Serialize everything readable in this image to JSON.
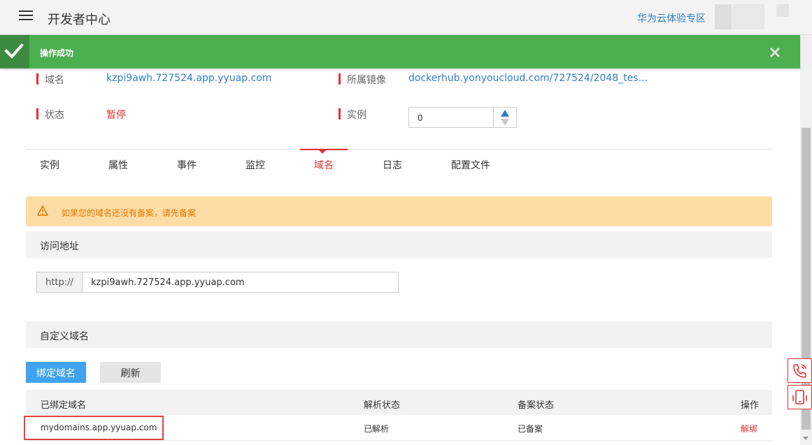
{
  "header": {
    "title": "开发者中心",
    "cloud_link": "华为云体验专区"
  },
  "toast": {
    "message": "操作成功"
  },
  "info": {
    "domain_label": "域名",
    "domain_value": "kzpi9awh.727524.app.yyuap.com",
    "image_label": "所属镜像",
    "image_value": "dockerhub.yonyoucloud.com/727524/2048_tes...",
    "status_label": "状态",
    "status_value": "暂停",
    "instance_label": "实例",
    "instance_value": "0"
  },
  "tabs": [
    {
      "label": "实例"
    },
    {
      "label": "属性"
    },
    {
      "label": "事件"
    },
    {
      "label": "监控"
    },
    {
      "label": "域名"
    },
    {
      "label": "日志"
    },
    {
      "label": "配置文件"
    }
  ],
  "active_tab": "域名",
  "warning": {
    "text": "如果您的域名还没有备案，请先备案"
  },
  "access": {
    "section_title": "访问地址",
    "prefix": "http://",
    "address": "kzpi9awh.727524.app.yyuap.com"
  },
  "custom_domain": {
    "section_title": "自定义域名",
    "bind_button": "绑定域名",
    "refresh_button": "刷新",
    "columns": [
      "已绑定域名",
      "解析状态",
      "备案状态",
      "操作"
    ],
    "rows": [
      {
        "domain": "mydomains.app.yyuap.com",
        "resolve_status": "已解析",
        "record_status": "已备案",
        "action": "解绑"
      }
    ]
  },
  "colors": {
    "success_green": "#4caf50",
    "accent_red": "#e03131",
    "link_blue": "#2f7fc4",
    "primary_button": "#3fa3ef",
    "warning_bg": "#fddca5"
  },
  "icons": [
    "menu-icon",
    "check-icon",
    "close-icon",
    "warning-icon",
    "phone-icon",
    "mobile-icon"
  ]
}
